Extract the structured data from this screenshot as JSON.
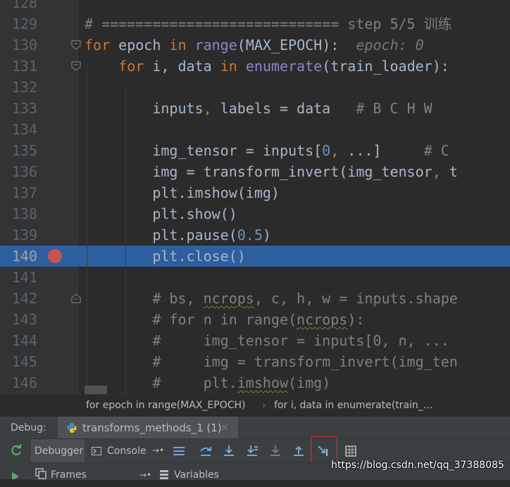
{
  "editor": {
    "lines": [
      {
        "n": "128",
        "tokens": []
      },
      {
        "n": "129",
        "tokens": [
          {
            "c": "cm",
            "t": "# ============================ step 5/5 训练"
          }
        ]
      },
      {
        "n": "130",
        "tokens": [
          {
            "c": "kw",
            "t": "for"
          },
          {
            "c": "",
            "t": " epoch "
          },
          {
            "c": "kw",
            "t": "in"
          },
          {
            "c": "",
            "t": " "
          },
          {
            "c": "bi",
            "t": "range"
          },
          {
            "c": "",
            "t": "(MAX_EPOCH):  "
          },
          {
            "c": "hint",
            "t": "epoch: 0"
          }
        ]
      },
      {
        "n": "131",
        "tokens": [
          {
            "c": "",
            "t": "    "
          },
          {
            "c": "kw",
            "t": "for"
          },
          {
            "c": "",
            "t": " i, data "
          },
          {
            "c": "kw",
            "t": "in"
          },
          {
            "c": "",
            "t": " "
          },
          {
            "c": "bi",
            "t": "enumerate"
          },
          {
            "c": "",
            "t": "(train_loader):"
          }
        ]
      },
      {
        "n": "132",
        "tokens": []
      },
      {
        "n": "133",
        "tokens": [
          {
            "c": "",
            "t": "        inputs"
          },
          {
            "c": "kw",
            "t": ","
          },
          {
            "c": "",
            "t": " labels = data   "
          },
          {
            "c": "cm",
            "t": "# B C H W"
          }
        ]
      },
      {
        "n": "134",
        "tokens": []
      },
      {
        "n": "135",
        "tokens": [
          {
            "c": "",
            "t": "        img_tensor = inputs["
          },
          {
            "c": "num",
            "t": "0"
          },
          {
            "c": "kw",
            "t": ","
          },
          {
            "c": "",
            "t": " ...]     "
          },
          {
            "c": "cm",
            "t": "# C"
          }
        ]
      },
      {
        "n": "136",
        "tokens": [
          {
            "c": "",
            "t": "        img = transform_invert(img_tensor"
          },
          {
            "c": "kw",
            "t": ","
          },
          {
            "c": "",
            "t": " t"
          }
        ]
      },
      {
        "n": "137",
        "tokens": [
          {
            "c": "",
            "t": "        plt.imshow(img)"
          }
        ]
      },
      {
        "n": "138",
        "tokens": [
          {
            "c": "",
            "t": "        plt.show()"
          }
        ]
      },
      {
        "n": "139",
        "tokens": [
          {
            "c": "",
            "t": "        plt.pause("
          },
          {
            "c": "num",
            "t": "0.5"
          },
          {
            "c": "",
            "t": ")"
          }
        ]
      },
      {
        "n": "140",
        "tokens": [
          {
            "c": "",
            "t": "        plt.close()"
          }
        ]
      },
      {
        "n": "141",
        "tokens": []
      },
      {
        "n": "142",
        "tokens": [
          {
            "c": "cm",
            "t": "        # bs, "
          },
          {
            "c": "cm squig",
            "t": "ncrops"
          },
          {
            "c": "cm",
            "t": ", c, h, w = inputs.shape"
          }
        ]
      },
      {
        "n": "143",
        "tokens": [
          {
            "c": "cm",
            "t": "        # for n in range("
          },
          {
            "c": "cm squig",
            "t": "ncrops"
          },
          {
            "c": "cm",
            "t": "):"
          }
        ]
      },
      {
        "n": "144",
        "tokens": [
          {
            "c": "cm",
            "t": "        #     img_tensor = inputs[0, n, ..."
          }
        ]
      },
      {
        "n": "145",
        "tokens": [
          {
            "c": "cm",
            "t": "        #     img = transform_invert(img_ten"
          }
        ]
      },
      {
        "n": "146",
        "tokens": [
          {
            "c": "cm",
            "t": "        #     plt."
          },
          {
            "c": "cm squig",
            "t": "imshow"
          },
          {
            "c": "cm",
            "t": "(img)"
          }
        ]
      }
    ],
    "current_line": "140"
  },
  "breadcrumb": {
    "items": [
      "for epoch in range(MAX_EPOCH)",
      "for i, data in enumerate(train_..."
    ],
    "separator": "›"
  },
  "debug_panel": {
    "label": "Debug:",
    "tab_title": "transforms_methods_1 (1)",
    "tab_close": "×",
    "tabs": {
      "debugger": "Debugger",
      "console": "Console"
    },
    "frames_label": "Frames",
    "variables_label": "Variables"
  },
  "toolbar_icons": [
    "rerun-icon",
    "show-execution-point-icon",
    "step-over-icon",
    "step-into-icon",
    "step-into-my-code-icon",
    "force-step-into-icon",
    "step-out-icon",
    "run-to-cursor-icon",
    "evaluate-expression-icon"
  ],
  "colors": {
    "editor_bg": "#2b2b2b",
    "keyword": "#cc7832",
    "builtin": "#8888c6",
    "number": "#6897bb",
    "comment": "#808080",
    "current_line": "#2d5e9f",
    "breakpoint": "#c75450",
    "highlight_box": "#d03030"
  },
  "watermark": "https://blog.csdn.net/qq_37388085"
}
